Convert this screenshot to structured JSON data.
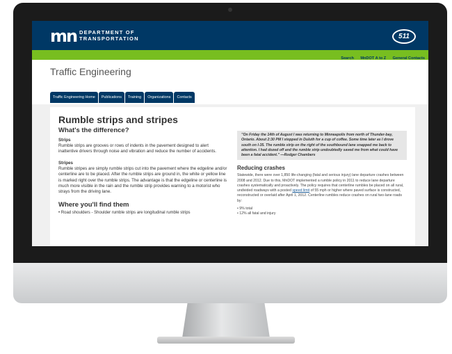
{
  "header": {
    "logo_mark": "mn",
    "dept_line1": "DEPARTMENT OF",
    "dept_line2": "TRANSPORTATION",
    "badge_511": "511"
  },
  "topnav": {
    "links": [
      "Search",
      "MnDOT A to Z",
      "General Contacts"
    ]
  },
  "page_title": "Traffic Engineering",
  "tabs": [
    "Traffic Engineering Home",
    "Publications",
    "Training",
    "Organizations",
    "Contacts"
  ],
  "main": {
    "title": "Rumble strips and stripes",
    "subtitle": "What's the difference?",
    "strips_heading": "Strips",
    "strips_text": "Rumble strips are grooves or rows of indents in the pavement designed to alert inattentive drivers through noise and vibration and reduce the number of accidents.",
    "stripes_heading": "Stripes",
    "stripes_text": "Rumble stripes are simply rumble strips cut into the pavement where the edgeline and/or centerline are to be placed. After the rumble strips are ground in, the white or yellow line is marked right over the rumble strips. The advantage is that the edgeline or centerline is much more visible in the rain and the rumble strip provides warning to a motorist who strays from the driving lane.",
    "where_heading": "Where you'll find them",
    "where_item": "Road shoulders - Shoulder rumble strips are longitudinal rumble strips"
  },
  "sidebar": {
    "quote": "\"On Friday the 14th of August I was returning to Minneapolis from north of Thunder-bay, Ontario. About 2:30 PM I stopped in Duluth for a cup of coffee. Some time later as I drove south on I-35. The rumble strip on the right of the southbound lane snapped me back to attention. I had dozed off and the rumble strip undoubtedly saved me from what could have been a fatal accident.\" —Rodger Chambers",
    "reducing_heading": "Reducing crashes",
    "reducing_text_1": "Statewide, there were over 1,850 life-changing (fatal and serious injury) lane departure crashes between 2008 and 2012. Due to this, MnDOT implemented a rumble policy in 2011 to reduce lane departure crashes systematically and proactively. The policy requires that centerline rumbles be placed on all rural, undivided roadways with a posted",
    "reducing_link": "speed limit",
    "reducing_text_2": "of 55 mph or higher where paved surface is constructed, reconstructed or overlaid after April 1, 2012. Centerline rumbles reduce crashes on rural two-lane roads by:",
    "bullets": [
      "9% total",
      "12% all fatal and injury"
    ]
  }
}
